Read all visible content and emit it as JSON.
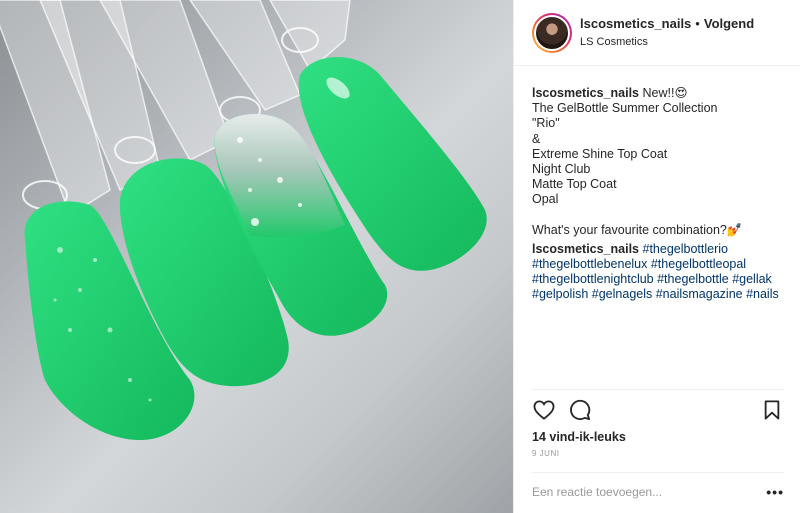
{
  "post": {
    "image_description_icon": "nail-swatches-photo",
    "header": {
      "username": "lscosmetics_nails",
      "separator": "•",
      "follow_label": "Volgend",
      "location": "LS Cosmetics"
    },
    "caption": {
      "username": "lscosmetics_nails",
      "lines": [
        "New!!😍",
        "The GelBottle Summer Collection",
        "\"Rio\"",
        "&",
        "Extreme Shine Top Coat",
        "Night Club",
        "Matte Top Coat",
        "Opal",
        "",
        "What's your favourite combination?💅"
      ]
    },
    "comment": {
      "username": "lscosmetics_nails",
      "hashtags": [
        "#thegelbottlerio",
        "#thegelbottlebenelux",
        "#thegelbottleopal",
        "#thegelbottlenightclub",
        "#thegelbottle",
        "#gellak",
        "#gelpolish",
        "#gelnagels",
        "#nailsmagazine",
        "#nails"
      ]
    },
    "actions": {
      "like_icon": "heart-icon",
      "comment_icon": "comment-bubble-icon",
      "save_icon": "bookmark-icon"
    },
    "likes_label": "14 vind-ik-leuks",
    "date": "9 JUNI",
    "add_comment_placeholder": "Een reactie toevoegen...",
    "more_label": "•••"
  },
  "colors": {
    "nail_green": "#1fcf6e",
    "hashtag_blue": "#003569",
    "text": "#262626",
    "muted": "#999999"
  }
}
